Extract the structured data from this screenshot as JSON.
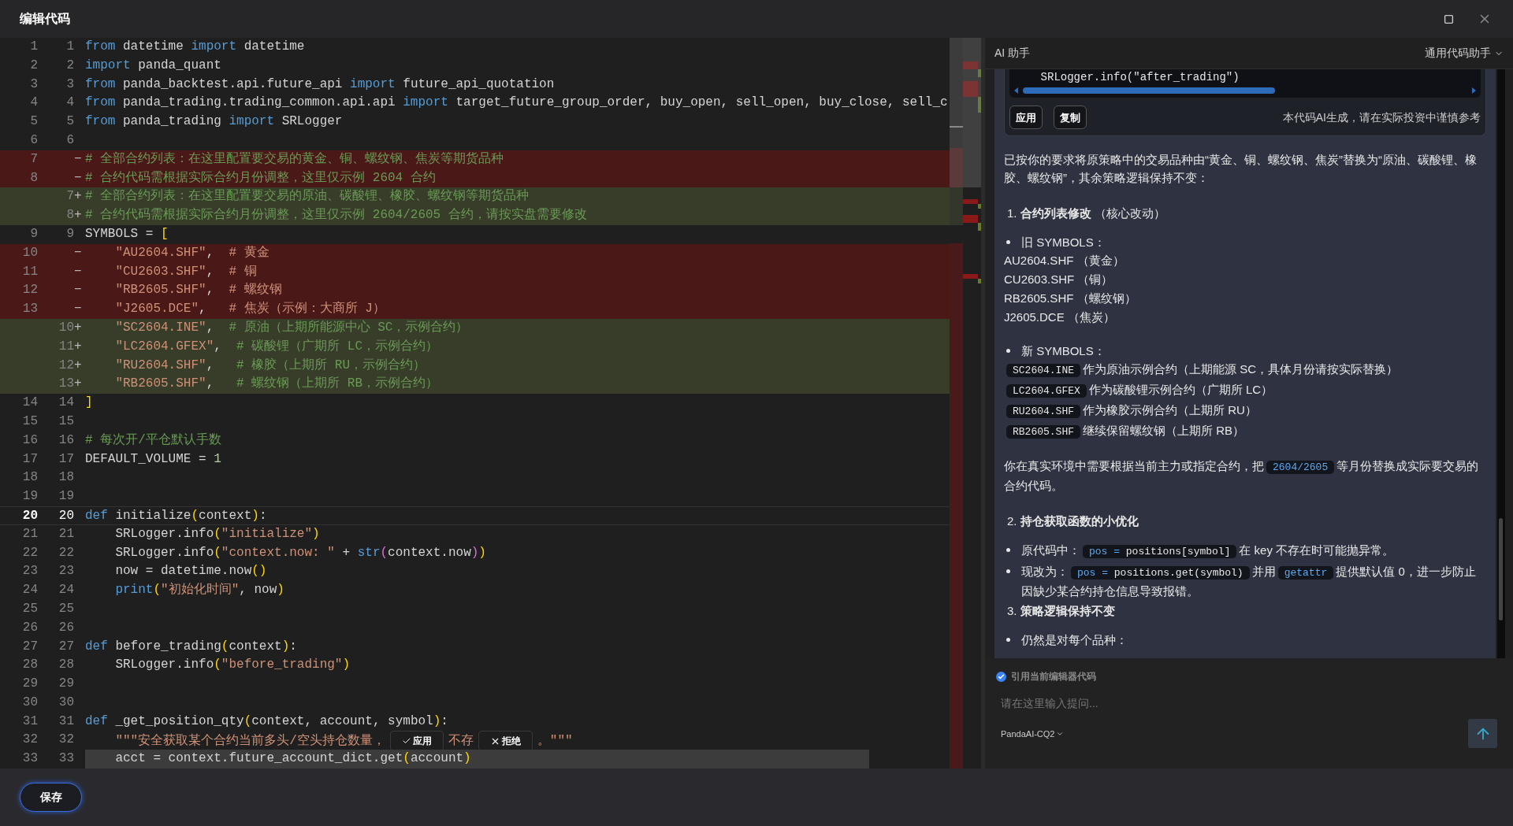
{
  "window": {
    "title": "编辑代码"
  },
  "editor": {
    "lines": [
      {
        "old": "1",
        "new": "1",
        "kind": "same",
        "current": false,
        "selected": false,
        "tokens": [
          {
            "kind": "kw",
            "t": "from"
          },
          {
            "kind": "pl",
            "t": " datetime "
          },
          {
            "kind": "kw",
            "t": "import"
          },
          {
            "kind": "pl",
            "t": " datetime"
          }
        ]
      },
      {
        "old": "2",
        "new": "2",
        "kind": "same",
        "current": false,
        "selected": false,
        "tokens": [
          {
            "kind": "kw",
            "t": "import"
          },
          {
            "kind": "pl",
            "t": " panda_quant"
          }
        ]
      },
      {
        "old": "3",
        "new": "3",
        "kind": "same",
        "current": false,
        "selected": false,
        "tokens": [
          {
            "kind": "kw",
            "t": "from"
          },
          {
            "kind": "pl",
            "t": " panda_backtest.api.future_api "
          },
          {
            "kind": "kw",
            "t": "import"
          },
          {
            "kind": "pl",
            "t": " future_api_quotation"
          }
        ]
      },
      {
        "old": "4",
        "new": "4",
        "kind": "same",
        "current": false,
        "selected": false,
        "tokens": [
          {
            "kind": "kw",
            "t": "from"
          },
          {
            "kind": "pl",
            "t": " panda_trading.trading_common.api.api "
          },
          {
            "kind": "kw",
            "t": "import"
          },
          {
            "kind": "pl",
            "t": " target_future_group_order, buy_open, sell_open, buy_close, sell_c"
          }
        ]
      },
      {
        "old": "5",
        "new": "5",
        "kind": "same",
        "current": false,
        "selected": false,
        "tokens": [
          {
            "kind": "kw",
            "t": "from"
          },
          {
            "kind": "pl",
            "t": " panda_trading "
          },
          {
            "kind": "kw",
            "t": "import"
          },
          {
            "kind": "pl",
            "t": " SRLogger"
          }
        ]
      },
      {
        "old": "6",
        "new": "6",
        "kind": "same",
        "current": false,
        "selected": false
      },
      {
        "old": "7",
        "sign": "−",
        "kind": "removed",
        "current": false,
        "selected": false,
        "tokens": [
          {
            "kind": "com",
            "t": "# 全部合约列表：在这里配置要交易的黄金、铜、螺纹钢、焦炭等期货品种"
          }
        ]
      },
      {
        "old": "8",
        "sign": "−",
        "kind": "removed",
        "current": false,
        "selected": false,
        "tokens": [
          {
            "kind": "com",
            "t": "# 合约代码需根据实际合约月份调整，这里仅示例 2604 合约"
          }
        ]
      },
      {
        "new": "7",
        "sign": "+",
        "kind": "added",
        "current": false,
        "selected": false,
        "tokens": [
          {
            "kind": "com",
            "t": "# 全部合约列表：在这里配置要交易的原油、碳酸锂、橡胶、螺纹钢等期货品种"
          }
        ]
      },
      {
        "new": "8",
        "sign": "+",
        "kind": "added",
        "current": false,
        "selected": false,
        "tokens": [
          {
            "kind": "com",
            "t": "# 合约代码需根据实际合约月份调整，这里仅示例 2604/2605 合约，请按实盘需要修改"
          }
        ]
      },
      {
        "old": "9",
        "new": "9",
        "kind": "same",
        "current": false,
        "selected": false,
        "tokens": [
          {
            "kind": "pl",
            "t": "SYMBOLS = "
          },
          {
            "kind": "br",
            "t": "["
          }
        ]
      },
      {
        "old": "10",
        "sign": "−",
        "kind": "removed",
        "current": false,
        "selected": false,
        "tokens": [
          {
            "kind": "str",
            "t": "    \"AU2604.SHF\""
          },
          {
            "kind": "pl",
            "t": ",  "
          },
          {
            "kind": "str",
            "t": "# 黄金"
          }
        ]
      },
      {
        "old": "11",
        "sign": "−",
        "kind": "removed",
        "current": false,
        "selected": false,
        "tokens": [
          {
            "kind": "str",
            "t": "    \"CU2603.SHF\""
          },
          {
            "kind": "pl",
            "t": ",  "
          },
          {
            "kind": "str",
            "t": "# 铜"
          }
        ]
      },
      {
        "old": "12",
        "sign": "−",
        "kind": "removed",
        "current": false,
        "selected": false,
        "tokens": [
          {
            "kind": "str",
            "t": "    \"RB2605.SHF\""
          },
          {
            "kind": "pl",
            "t": ",  "
          },
          {
            "kind": "str",
            "t": "# 螺纹钢"
          }
        ]
      },
      {
        "old": "13",
        "sign": "−",
        "kind": "removed",
        "current": false,
        "selected": false,
        "tokens": [
          {
            "kind": "str",
            "t": "    \"J2605.DCE\""
          },
          {
            "kind": "pl",
            "t": ",   "
          },
          {
            "kind": "str",
            "t": "# 焦炭（示例：大商所 J）"
          }
        ]
      },
      {
        "new": "10",
        "sign": "+",
        "kind": "added",
        "current": false,
        "selected": false,
        "tokens": [
          {
            "kind": "str",
            "t": "    \"SC2604.INE\""
          },
          {
            "kind": "pl",
            "t": ",  "
          },
          {
            "kind": "com",
            "t": "# 原油（上期所能源中心 SC，示例合约）"
          }
        ]
      },
      {
        "new": "11",
        "sign": "+",
        "kind": "added",
        "current": false,
        "selected": false,
        "tokens": [
          {
            "kind": "str",
            "t": "    \"LC2604.GFEX\""
          },
          {
            "kind": "pl",
            "t": ",  "
          },
          {
            "kind": "com",
            "t": "# 碳酸锂（广期所 LC，示例合约）"
          }
        ]
      },
      {
        "new": "12",
        "sign": "+",
        "kind": "added",
        "current": false,
        "selected": false,
        "tokens": [
          {
            "kind": "str",
            "t": "    \"RU2604.SHF\""
          },
          {
            "kind": "pl",
            "t": ",   "
          },
          {
            "kind": "com",
            "t": "# 橡胶（上期所 RU，示例合约）"
          }
        ]
      },
      {
        "new": "13",
        "sign": "+",
        "kind": "added",
        "current": false,
        "selected": false,
        "tokens": [
          {
            "kind": "str",
            "t": "    \"RB2605.SHF\""
          },
          {
            "kind": "pl",
            "t": ",   "
          },
          {
            "kind": "com",
            "t": "# 螺纹钢（上期所 RB，示例合约）"
          }
        ]
      },
      {
        "old": "14",
        "new": "14",
        "kind": "same",
        "current": false,
        "selected": false,
        "tokens": [
          {
            "kind": "br",
            "t": "]"
          }
        ]
      },
      {
        "old": "15",
        "new": "15",
        "kind": "same",
        "current": false,
        "selected": false
      },
      {
        "old": "16",
        "new": "16",
        "kind": "same",
        "current": false,
        "selected": false,
        "tokens": [
          {
            "kind": "com",
            "t": "# 每次开/平仓默认手数"
          }
        ]
      },
      {
        "old": "17",
        "new": "17",
        "kind": "same",
        "current": false,
        "selected": false,
        "tokens": [
          {
            "kind": "pl",
            "t": "DEFAULT_VOLUME = "
          },
          {
            "kind": "num",
            "t": "1"
          }
        ]
      },
      {
        "old": "18",
        "new": "18",
        "kind": "same",
        "current": false,
        "selected": false
      },
      {
        "old": "19",
        "new": "19",
        "kind": "same",
        "current": false,
        "selected": false
      },
      {
        "old": "20",
        "new": "20",
        "kind": "same",
        "current": true,
        "selected": false,
        "tokens": [
          {
            "kind": "kw",
            "t": "def"
          },
          {
            "kind": "pl",
            "t": " initialize"
          },
          {
            "kind": "br",
            "t": "("
          },
          {
            "kind": "pl",
            "t": "context"
          },
          {
            "kind": "br",
            "t": ")"
          },
          {
            "kind": "pl",
            "t": ":"
          }
        ]
      },
      {
        "old": "21",
        "new": "21",
        "kind": "same",
        "current": false,
        "selected": false,
        "tokens": [
          {
            "kind": "pl",
            "t": "    SRLogger.info"
          },
          {
            "kind": "br",
            "t": "("
          },
          {
            "kind": "str",
            "t": "\"initialize\""
          },
          {
            "kind": "br",
            "t": ")"
          }
        ]
      },
      {
        "old": "22",
        "new": "22",
        "kind": "same",
        "current": false,
        "selected": false,
        "tokens": [
          {
            "kind": "pl",
            "t": "    SRLogger.info"
          },
          {
            "kind": "br",
            "t": "("
          },
          {
            "kind": "str",
            "t": "\"context.now: \""
          },
          {
            "kind": "pl",
            "t": " + "
          },
          {
            "kind": "kw",
            "t": "str"
          },
          {
            "kind": "br2",
            "t": "("
          },
          {
            "kind": "pl",
            "t": "context.now"
          },
          {
            "kind": "br2",
            "t": ")"
          },
          {
            "kind": "br",
            "t": ")"
          }
        ]
      },
      {
        "old": "23",
        "new": "23",
        "kind": "same",
        "current": false,
        "selected": false,
        "tokens": [
          {
            "kind": "pl",
            "t": "    now = datetime.now"
          },
          {
            "kind": "br",
            "t": "()"
          }
        ]
      },
      {
        "old": "24",
        "new": "24",
        "kind": "same",
        "current": false,
        "selected": false,
        "tokens": [
          {
            "kind": "kw",
            "t": "    print"
          },
          {
            "kind": "br",
            "t": "("
          },
          {
            "kind": "str",
            "t": "\"初始化时间\""
          },
          {
            "kind": "pl",
            "t": ", now"
          },
          {
            "kind": "br",
            "t": ")"
          }
        ]
      },
      {
        "old": "25",
        "new": "25",
        "kind": "same",
        "current": false,
        "selected": false
      },
      {
        "old": "26",
        "new": "26",
        "kind": "same",
        "current": false,
        "selected": false
      },
      {
        "old": "27",
        "new": "27",
        "kind": "same",
        "current": false,
        "selected": false,
        "tokens": [
          {
            "kind": "kw",
            "t": "def"
          },
          {
            "kind": "pl",
            "t": " before_trading"
          },
          {
            "kind": "br",
            "t": "("
          },
          {
            "kind": "pl",
            "t": "context"
          },
          {
            "kind": "br",
            "t": ")"
          },
          {
            "kind": "pl",
            "t": ":"
          }
        ]
      },
      {
        "old": "28",
        "new": "28",
        "kind": "same",
        "current": false,
        "selected": false,
        "tokens": [
          {
            "kind": "pl",
            "t": "    SRLogger.info"
          },
          {
            "kind": "br",
            "t": "("
          },
          {
            "kind": "str",
            "t": "\"before_trading\""
          },
          {
            "kind": "br",
            "t": ")"
          }
        ]
      },
      {
        "old": "29",
        "new": "29",
        "kind": "same",
        "current": false,
        "selected": false
      },
      {
        "old": "30",
        "new": "30",
        "kind": "same",
        "current": false,
        "selected": false
      },
      {
        "old": "31",
        "new": "31",
        "kind": "same",
        "current": false,
        "selected": false,
        "tokens": [
          {
            "kind": "kw",
            "t": "def"
          },
          {
            "kind": "pl",
            "t": " _get_position_qty"
          },
          {
            "kind": "br",
            "t": "("
          },
          {
            "kind": "pl",
            "t": "context, account, symbol"
          },
          {
            "kind": "br",
            "t": ")"
          },
          {
            "kind": "pl",
            "t": ":"
          }
        ]
      },
      {
        "old": "32",
        "new": "32",
        "kind": "same",
        "current": false,
        "selected": false,
        "tokens": [
          {
            "kind": "str",
            "t": "    \"\"\"安全获取某个合约当前多头/空头持仓数量，"
          },
          {
            "kind": "accept",
            "t": "应用"
          },
          {
            "kind": "str",
            "t": "不存"
          },
          {
            "kind": "reject",
            "t": "拒绝"
          },
          {
            "kind": "str",
            "t": "。\"\"\""
          }
        ]
      },
      {
        "old": "33",
        "new": "33",
        "kind": "same",
        "current": false,
        "selected": true,
        "tokens": [
          {
            "kind": "pl",
            "t": "    acct = context.future_account_dict.get"
          },
          {
            "kind": "br",
            "t": "("
          },
          {
            "kind": "pl",
            "t": "account"
          },
          {
            "kind": "br",
            "t": ")"
          }
        ]
      }
    ]
  },
  "assistant": {
    "title": "AI 助手",
    "mode": "通用代码助手",
    "snippet": {
      "code": "    SRLogger.info(\"after_trading\")",
      "buttons": [
        "应用",
        "复制"
      ],
      "note": "本代码AI生成，请在实际投资中谨慎参考"
    },
    "blocks": [
      {
        "kind": "para",
        "parts": [
          {
            "t": "已按你的要求将原策略中的交易品种由“黄金、铜、螺纹钢、焦炭”替换为“原油、碳酸锂、橡胶、螺纹钢”，其余策略逻辑保持不变："
          }
        ]
      },
      {
        "kind": "heading",
        "num": "1.",
        "title": "合约列表修改",
        "note": "（核心改动）"
      },
      {
        "kind": "bullet",
        "parts": [
          {
            "t": "旧 SYMBOLS："
          }
        ],
        "lines": [
          [
            {
              "t": "AU2604.SHF （黄金）"
            }
          ],
          [
            {
              "t": "CU2603.SHF （铜）"
            }
          ],
          [
            {
              "t": "RB2605.SHF （螺纹钢）"
            }
          ],
          [
            {
              "t": "J2605.DCE  （焦炭）"
            }
          ]
        ]
      },
      {
        "kind": "bullet",
        "parts": [
          {
            "t": "新 SYMBOLS："
          }
        ],
        "lines": [
          [
            {
              "code": [
                {
                  "kind": "pl",
                  "t": "SC2604.INE"
                }
              ]
            },
            {
              "t": "作为原油示例合约（上期能源 SC，具体月份请按实际替换）"
            }
          ],
          [
            {
              "code": [
                {
                  "kind": "pl",
                  "t": "LC2604.GFEX"
                }
              ]
            },
            {
              "t": "作为碳酸锂示例合约（广期所 LC）"
            }
          ],
          [
            {
              "code": [
                {
                  "kind": "pl",
                  "t": "RU2604.SHF"
                }
              ]
            },
            {
              "t": "作为橡胶示例合约（上期所 RU）"
            }
          ],
          [
            {
              "code": [
                {
                  "kind": "pl",
                  "t": "RB2605.SHF"
                }
              ]
            },
            {
              "t": "继续保留螺纹钢（上期所 RB）"
            }
          ]
        ]
      },
      {
        "kind": "para",
        "parts": [
          {
            "t": "你在真实环境中需要根据当前主力或指定合约，把"
          },
          {
            "code": [
              {
                "kind": "kw",
                "t": "2604/2605"
              }
            ]
          },
          {
            "t": "等月份替换成实际要交易的合约代码。"
          }
        ]
      },
      {
        "kind": "heading",
        "num": "2.",
        "title": "持仓获取函数的小优化"
      },
      {
        "kind": "bullet",
        "parts": [
          {
            "t": "原代码中："
          },
          {
            "code": [
              {
                "kind": "kw",
                "t": "pos = "
              },
              {
                "kind": "pl",
                "t": "positions[symbol]"
              }
            ]
          },
          {
            "t": "在 key 不存在时可能抛异常。"
          }
        ]
      },
      {
        "kind": "bullet",
        "parts": [
          {
            "t": "现改为："
          },
          {
            "code": [
              {
                "kind": "kw",
                "t": "pos = "
              },
              {
                "kind": "pl",
                "t": "positions.get(symbol)"
              }
            ]
          },
          {
            "t": "并用"
          },
          {
            "code": [
              {
                "kind": "kw",
                "t": "getattr"
              }
            ]
          },
          {
            "t": "提供默认值 0，进一步防止因缺少某合约持仓信息导致报错。"
          }
        ]
      },
      {
        "kind": "heading",
        "num": "3.",
        "title": "策略逻辑保持不变"
      },
      {
        "kind": "bullet",
        "parts": [
          {
            "t": "仍然是对每个品种："
          }
        ]
      }
    ],
    "input": {
      "quote_label": "引用当前编辑器代码",
      "quote_checked": true,
      "placeholder": "请在这里输入提问...",
      "model": "PandaAI-CQ2"
    }
  },
  "footer": {
    "save": "保存"
  }
}
